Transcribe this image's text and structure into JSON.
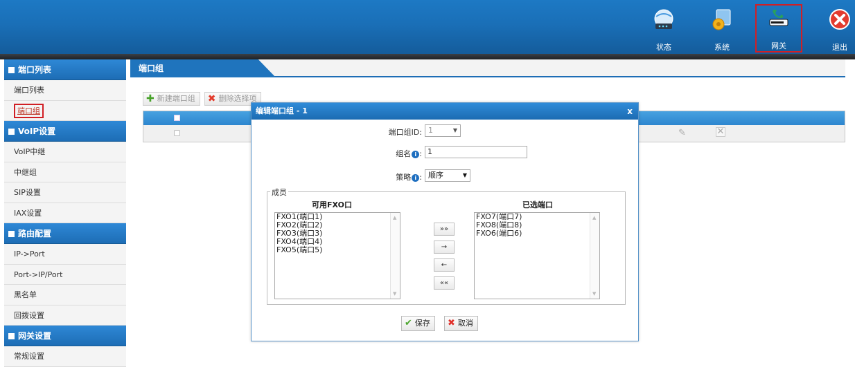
{
  "nav": {
    "items": [
      {
        "label": "状态",
        "icon": "status-globe-icon"
      },
      {
        "label": "系统",
        "icon": "system-settings-icon"
      },
      {
        "label": "网关",
        "icon": "gateway-phone-icon",
        "active": true
      },
      {
        "label": "退出",
        "icon": "exit-icon"
      }
    ]
  },
  "sidebar": {
    "sections": [
      {
        "title": "端口列表",
        "items": [
          "端口列表",
          "端口组"
        ]
      },
      {
        "title": "VoIP设置",
        "items": [
          "VoIP中继",
          "中继组",
          "SIP设置",
          "IAX设置"
        ]
      },
      {
        "title": "路由配置",
        "items": [
          "IP->Port",
          "Port->IP/Port",
          "黑名单",
          "回拨设置"
        ]
      },
      {
        "title": "网关设置",
        "items": [
          "常规设置"
        ]
      }
    ],
    "current": "端口组"
  },
  "main": {
    "tab": "端口组",
    "toolbar": {
      "new_label": "新建端口组",
      "delete_label": "删除选择项"
    }
  },
  "dialog": {
    "title": "编辑端口组 - 1",
    "close_label": "x",
    "group_id_label": "端口组ID:",
    "group_id_value": "1",
    "name_label": "组名",
    "name_value": "1",
    "strategy_label": "策略",
    "strategy_value": "顺序",
    "members_legend": "成员",
    "available_title": "可用FXO口",
    "selected_title": "已选端口",
    "available": [
      "FXO1(端口1)",
      "FXO2(端口2)",
      "FXO3(端口3)",
      "FXO4(端口4)",
      "FXO5(端口5)"
    ],
    "selected": [
      "FXO7(端口7)",
      "FXO8(端口8)",
      "FXO6(端口6)"
    ],
    "move_all_right": "»»",
    "move_right": "→",
    "move_left": "←",
    "move_all_left": "««",
    "save_label": "保存",
    "cancel_label": "取消"
  },
  "colors": {
    "accent": "#1d6db5",
    "highlight": "#d11f25"
  }
}
